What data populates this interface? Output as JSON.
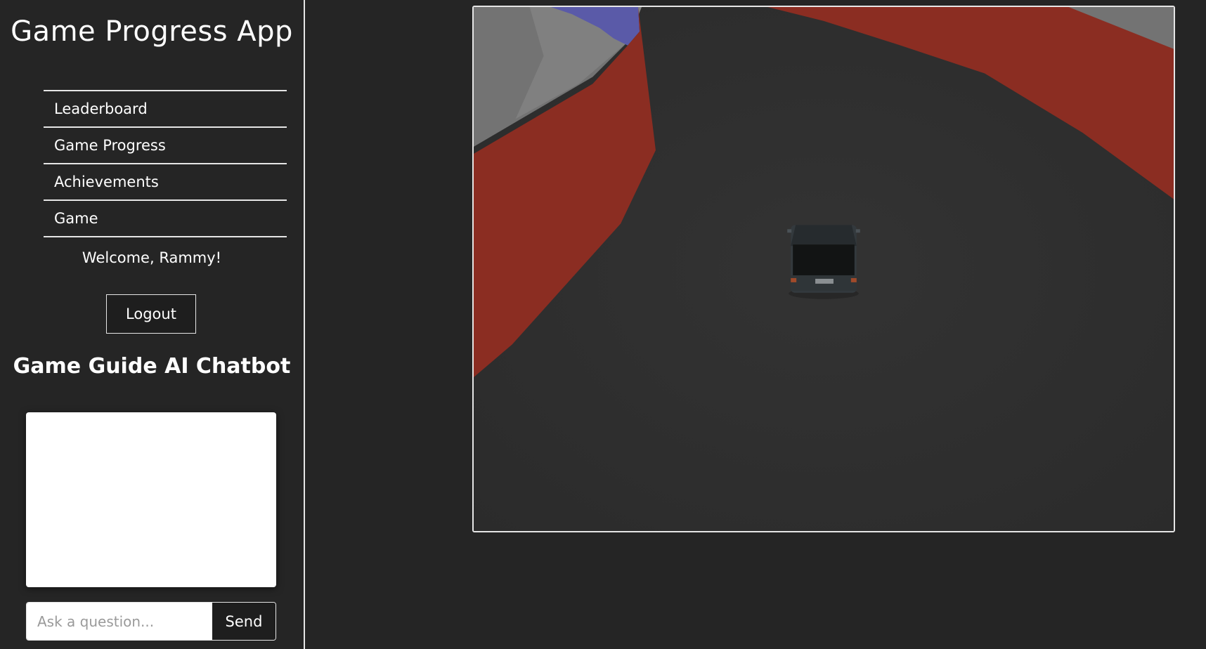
{
  "app": {
    "title": "Game Progress App"
  },
  "nav": {
    "items": [
      {
        "label": "Leaderboard"
      },
      {
        "label": "Game Progress"
      },
      {
        "label": "Achievements"
      },
      {
        "label": "Game"
      }
    ]
  },
  "user": {
    "welcome": "Welcome, Rammy!"
  },
  "auth": {
    "logout_label": "Logout"
  },
  "chatbot": {
    "title": "Game Guide AI Chatbot",
    "input_placeholder": "Ask a question...",
    "input_value": "",
    "send_label": "Send"
  },
  "game": {
    "track_color": "#2e2e2e",
    "barrier_color": "#8b2d22",
    "ground_color": "#737373",
    "water_color": "#5a5aa8",
    "vehicle": "car-rear-view"
  }
}
